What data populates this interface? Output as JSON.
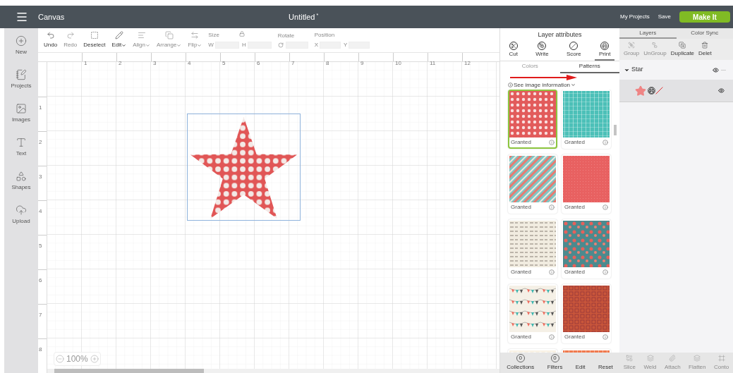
{
  "header": {
    "title": "Canvas",
    "document": "Untitled",
    "unsaved_mark": "*",
    "links": [
      "My Projects",
      "Save"
    ],
    "primary_button": "Make It"
  },
  "sidebar": {
    "items": [
      {
        "label": "New"
      },
      {
        "label": "Projects"
      },
      {
        "label": "Images"
      },
      {
        "label": "Text"
      },
      {
        "label": "Shapes"
      },
      {
        "label": "Upload"
      }
    ]
  },
  "toolbar": {
    "tools": [
      {
        "label": "Undo",
        "disabled": false,
        "menu": false
      },
      {
        "label": "Redo",
        "disabled": true,
        "menu": false
      },
      {
        "label": "Deselect",
        "disabled": false,
        "menu": false
      },
      {
        "label": "Edit",
        "disabled": false,
        "menu": true
      },
      {
        "label": "Align",
        "disabled": true,
        "menu": true
      },
      {
        "label": "Arrange",
        "disabled": true,
        "menu": true
      },
      {
        "label": "Flip",
        "disabled": true,
        "menu": true
      }
    ],
    "size": {
      "label": "Size",
      "fields": [
        {
          "label": "W"
        },
        {
          "label": "H"
        }
      ]
    },
    "rotate": {
      "label": "Rotate"
    },
    "position": {
      "label": "Position",
      "fields": [
        {
          "label": "X"
        },
        {
          "label": "Y"
        }
      ]
    }
  },
  "ruler": {
    "columns": [
      "1",
      "2",
      "3",
      "4",
      "5",
      "6",
      "7",
      "8",
      "9",
      "10",
      "11",
      "12"
    ],
    "rows": [
      "1",
      "2",
      "3",
      "4",
      "5",
      "6",
      "7",
      "8"
    ]
  },
  "zoom": {
    "value": "100%"
  },
  "layer_attributes": {
    "title": "Layer attributes",
    "operations": [
      {
        "label": "Cut",
        "selected": false
      },
      {
        "label": "Write",
        "selected": false
      },
      {
        "label": "Score",
        "selected": false
      },
      {
        "label": "Print",
        "selected": true
      }
    ],
    "tabs": [
      {
        "label": "Colors",
        "selected": false
      },
      {
        "label": "Patterns",
        "selected": true
      }
    ],
    "info_link": "See image information",
    "patterns": [
      {
        "kind": "dots",
        "color": "#e25b5b",
        "label": "Granted",
        "selected": true
      },
      {
        "kind": "weave",
        "color": "#4cc0b8",
        "label": "Granted",
        "selected": false
      },
      {
        "kind": "stripes",
        "color": "#7fc6c4",
        "label": "Granted",
        "selected": false
      },
      {
        "kind": "solid",
        "color": "#e86161",
        "label": "Granted",
        "selected": false
      },
      {
        "kind": "script",
        "color": "#f1ece0",
        "label": "Granted",
        "selected": false
      },
      {
        "kind": "floral",
        "color": "#4c8a8e",
        "label": "Granted",
        "selected": false
      },
      {
        "kind": "bunting",
        "color": "#f5f0e6",
        "label": "Granted",
        "selected": false
      },
      {
        "kind": "tiles",
        "color": "#c9563a",
        "label": "Granted",
        "selected": false
      },
      {
        "kind": "dots",
        "color": "#f8f1e4",
        "selected": false
      },
      {
        "kind": "weave",
        "color": "#f07a4e",
        "selected": false
      }
    ],
    "bottom_actions": [
      {
        "label": "Collections",
        "count": "0"
      },
      {
        "label": "Filters",
        "count": "0"
      },
      {
        "label": "Edit"
      },
      {
        "label": "Reset"
      }
    ]
  },
  "layers_panel": {
    "tabs": [
      {
        "label": "Layers",
        "selected": true
      },
      {
        "label": "Color Sync",
        "selected": false
      }
    ],
    "tools": [
      {
        "label": "Group",
        "disabled": true
      },
      {
        "label": "UnGroup",
        "disabled": true
      },
      {
        "label": "Duplicate",
        "disabled": false
      },
      {
        "label": "Delet",
        "disabled": false
      }
    ],
    "layers": [
      {
        "name": "Star",
        "expanded": true,
        "visible": true,
        "children": [
          {
            "visible": true
          }
        ]
      }
    ],
    "actions": [
      {
        "label": "Slice",
        "disabled": true
      },
      {
        "label": "Weld",
        "disabled": true
      },
      {
        "label": "Attach",
        "disabled": true
      },
      {
        "label": "Flatten",
        "disabled": true
      },
      {
        "label": "Conto",
        "disabled": true
      }
    ]
  }
}
